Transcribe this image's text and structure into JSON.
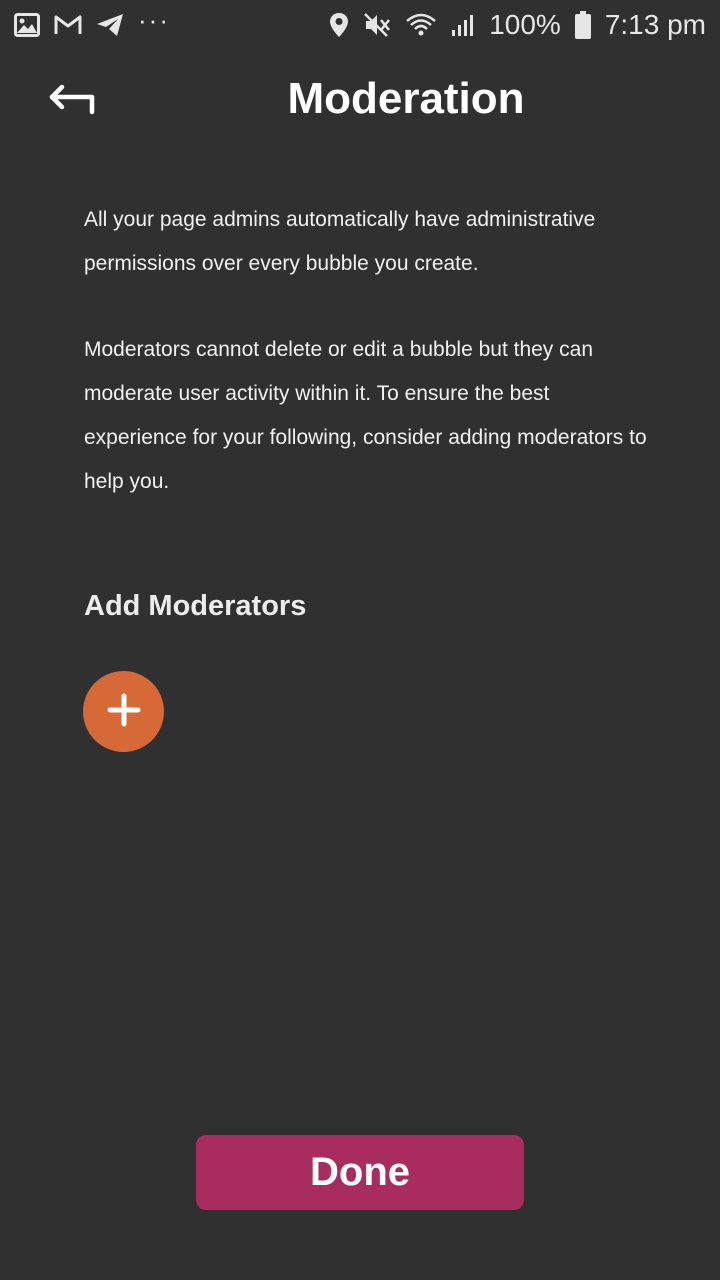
{
  "status_bar": {
    "icons_left": [
      "image-icon",
      "gmail-icon",
      "telegram-icon"
    ],
    "more_dots": "···",
    "icons_right": [
      "location-icon",
      "mute-icon",
      "wifi-icon",
      "signal-icon"
    ],
    "battery_text": "100%",
    "battery_icon": "battery-icon",
    "time": "7:13 pm"
  },
  "header": {
    "back_icon": "back-arrow-icon",
    "title": "Moderation"
  },
  "content": {
    "paragraph_1": "All your page admins automatically have administrative permissions over every bubble you create.",
    "paragraph_2": "Moderators cannot delete or edit a bubble but they can moderate user activity within it. To ensure the best experience for your following, consider adding moderators to help you."
  },
  "moderators": {
    "section_title": "Add Moderators",
    "add_icon": "plus-icon"
  },
  "footer": {
    "done_label": "Done"
  },
  "colors": {
    "background": "#303030",
    "accent_add": "#d66a36",
    "accent_done": "#a82c5e",
    "text": "#ffffff"
  }
}
